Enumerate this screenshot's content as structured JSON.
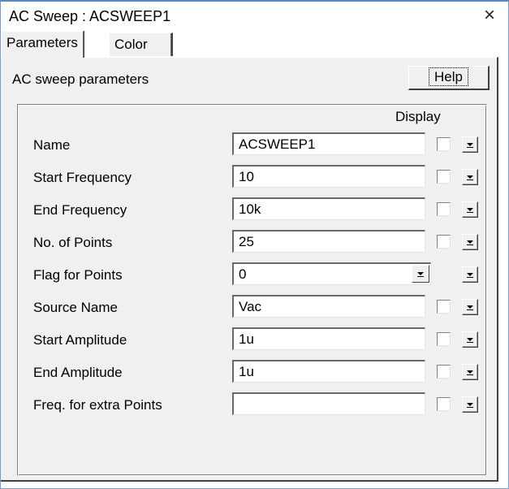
{
  "window": {
    "title": "AC Sweep : ACSWEEP1",
    "close_glyph": "×"
  },
  "tabs": [
    {
      "label": "Parameters",
      "active": true
    },
    {
      "label": "Color",
      "active": false
    }
  ],
  "panel": {
    "title": "AC sweep parameters",
    "help_label": "Help",
    "display_header": "Display"
  },
  "rows": [
    {
      "label": "Name",
      "value": "ACSWEEP1",
      "type": "text",
      "checked": false
    },
    {
      "label": "Start Frequency",
      "value": "10",
      "type": "text",
      "checked": false
    },
    {
      "label": "End Frequency",
      "value": "10k",
      "type": "text",
      "checked": false
    },
    {
      "label": "No. of Points",
      "value": "25",
      "type": "text",
      "checked": false
    },
    {
      "label": "Flag for Points",
      "value": "0",
      "type": "select",
      "checked": false
    },
    {
      "label": "Source Name",
      "value": "Vac",
      "type": "text",
      "checked": false
    },
    {
      "label": "Start Amplitude",
      "value": "1u",
      "type": "text",
      "checked": false
    },
    {
      "label": "End Amplitude",
      "value": "1u",
      "type": "text",
      "checked": false
    },
    {
      "label": "Freq. for extra Points",
      "value": "",
      "type": "text",
      "checked": false
    }
  ],
  "icons": {
    "close": "close-icon",
    "dropdown": "chevron-down-icon"
  }
}
